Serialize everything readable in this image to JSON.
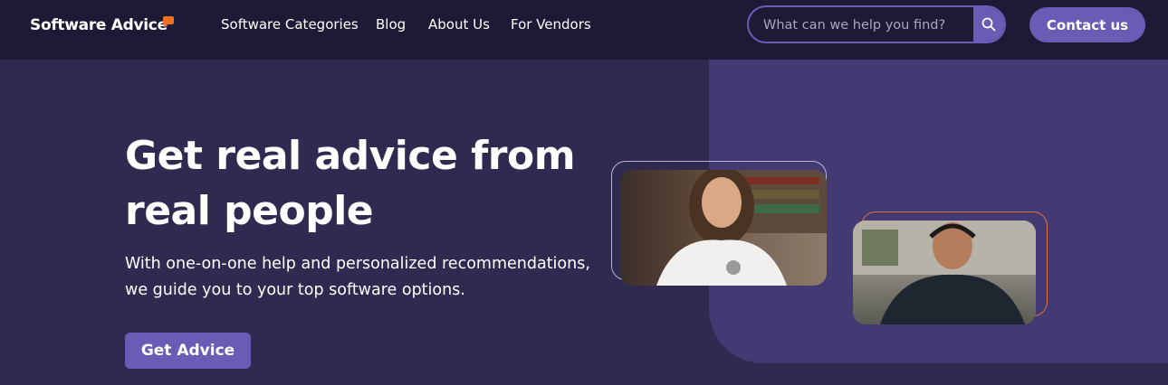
{
  "header": {
    "logo_text": "Software Advice",
    "logo_reg": ".",
    "nav": [
      {
        "label": "Software Categories"
      },
      {
        "label": "Blog"
      },
      {
        "label": "About Us"
      },
      {
        "label": "For Vendors"
      }
    ],
    "search_placeholder": "What can we help you find?",
    "contact_label": "Contact us"
  },
  "hero": {
    "headline_line1": "Get real advice from",
    "headline_line2": "real people",
    "sub_line1": "With one-on-one help and personalized recommendations,",
    "sub_line2": "we guide you to your top software options.",
    "cta_label": "Get Advice"
  },
  "colors": {
    "topbar": "#1d1a35",
    "hero_bg": "#2f2a50",
    "panel": "#433a74",
    "accent": "#6a5cb5",
    "logo_mark": "#f26f21"
  },
  "icons": {
    "search": "search-icon",
    "logo_mark": "speech-bubble-icon"
  }
}
